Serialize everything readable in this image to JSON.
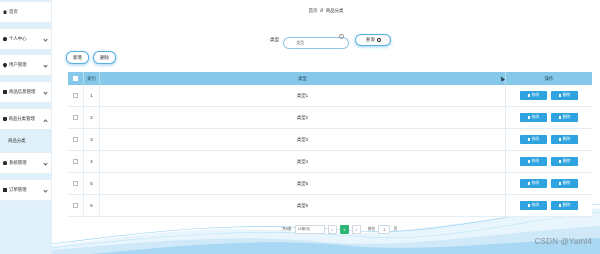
{
  "sidebar": {
    "items": [
      {
        "label": "首页",
        "icon": "home-icon"
      },
      {
        "label": "个人中心",
        "icon": "user-icon"
      },
      {
        "label": "用户管理",
        "icon": "pin-icon"
      },
      {
        "label": "商品信息管理",
        "icon": "grid-icon"
      },
      {
        "label": "商品分类管理",
        "icon": "doc-icon"
      },
      {
        "label": "商品分类",
        "icon": ""
      },
      {
        "label": "系统管理",
        "icon": "user-icon"
      },
      {
        "label": "订单管理",
        "icon": "grid-icon"
      }
    ]
  },
  "breadcrumb": {
    "home": "首页",
    "sep": "//",
    "current": "商品分类"
  },
  "search": {
    "label": "类型",
    "placeholder": "类型",
    "button": "查询"
  },
  "actions": {
    "add": "新增",
    "delete": "删除"
  },
  "table": {
    "headers": {
      "index": "索引",
      "type": "类型",
      "ops": "操作"
    },
    "rows": [
      {
        "index": "1",
        "type": "类型1"
      },
      {
        "index": "2",
        "type": "类型2"
      },
      {
        "index": "3",
        "type": "类型3"
      },
      {
        "index": "4",
        "type": "类型4"
      },
      {
        "index": "5",
        "type": "类型5"
      },
      {
        "index": "6",
        "type": "类型6"
      }
    ],
    "edit_label": "修改",
    "delete_label": "删除"
  },
  "pager": {
    "total": "共6条",
    "page_size": "10条/页",
    "prev": "<",
    "current_page": "1",
    "next": ">",
    "goto_label": "前往",
    "goto_value": "1",
    "page_suffix": "页"
  },
  "watermark": "CSDN @Yaml4",
  "colors": {
    "accent": "#2ea3e0",
    "header": "#86c8ea",
    "sidebar": "#dff0fa",
    "pager_active": "#2bb673"
  }
}
